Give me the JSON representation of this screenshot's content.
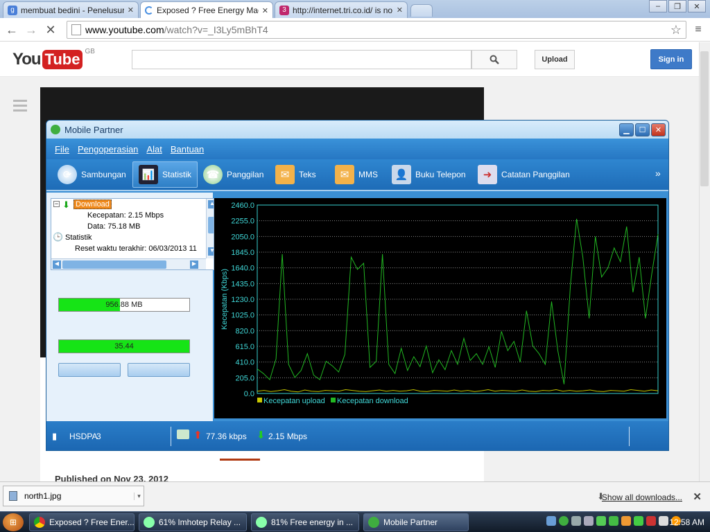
{
  "browser": {
    "tabs": [
      {
        "title": "membuat bedini - Penelusuran",
        "icon": "google-icon"
      },
      {
        "title": "Exposed ? Free Energy Magnet",
        "icon": "loading-icon",
        "active": true
      },
      {
        "title": "http://internet.tri.co.id/ is no",
        "icon": "tri-icon"
      }
    ],
    "url_host": "www.youtube.com",
    "url_path": "/watch?v=_I3Ly5mBhT4"
  },
  "youtube": {
    "logo_you": "You",
    "logo_tube": "Tube",
    "region": "GB",
    "upload_label": "Upload",
    "signin_label": "Sign in",
    "published": "Published on Nov 23, 2012"
  },
  "mobile_partner": {
    "title": "Mobile Partner",
    "menu": [
      "File",
      "Pengoperasian",
      "Alat",
      "Bantuan"
    ],
    "toolbar": [
      {
        "label": "Sambungan",
        "icon": "connection-icon"
      },
      {
        "label": "Statistik",
        "icon": "statistics-icon",
        "selected": true
      },
      {
        "label": "Panggilan",
        "icon": "phone-icon"
      },
      {
        "label": "Teks",
        "icon": "envelope-icon"
      },
      {
        "label": "MMS",
        "icon": "mms-icon"
      },
      {
        "label": "Buku Telepon",
        "icon": "phonebook-icon"
      },
      {
        "label": "Catatan Panggilan",
        "icon": "call-log-icon"
      }
    ],
    "tree": {
      "download": "Download",
      "speed": "Kecepatan: 2.15 Mbps",
      "data": "Data: 75.18 MB",
      "statistik": "Statistik",
      "reset": "Reset waktu terakhir: 06/03/2013 11"
    },
    "bar1": {
      "label": "956.88 MB",
      "fill": 0.47
    },
    "bar2": {
      "label": "35.44",
      "fill": 1.0
    },
    "status": {
      "network": "HSDPA",
      "signal": "3",
      "upload": "77.36 kbps",
      "download": "2.15 Mbps"
    }
  },
  "chart_data": {
    "type": "line",
    "ylabel": "Kecepatan (Kbps)",
    "ylim": [
      0,
      2460
    ],
    "yticks": [
      "0.0",
      "205.0",
      "410.0",
      "615.0",
      "820.0",
      "1025.0",
      "1230.0",
      "1435.0",
      "1640.0",
      "1845.0",
      "2050.0",
      "2255.0",
      "2460.0"
    ],
    "series": [
      {
        "name": "Kecepatan upload",
        "color": "#c8c800",
        "values": [
          30,
          40,
          25,
          35,
          50,
          30,
          20,
          45,
          30,
          25,
          40,
          35,
          30,
          50,
          40,
          30,
          25,
          35,
          45,
          30,
          40,
          30,
          35,
          50,
          30,
          25,
          40,
          35,
          30,
          45,
          30,
          40,
          25,
          35,
          50,
          30,
          40,
          35,
          30,
          45,
          30,
          25,
          40,
          35,
          50,
          30,
          40,
          30,
          35,
          45,
          30,
          25,
          40,
          35,
          30,
          50,
          40,
          30,
          45,
          35
        ]
      },
      {
        "name": "Kecepatan download",
        "color": "#22b822",
        "values": [
          320,
          260,
          180,
          450,
          1820,
          380,
          210,
          300,
          520,
          240,
          180,
          420,
          360,
          280,
          510,
          1780,
          1620,
          1700,
          340,
          420,
          1820,
          380,
          260,
          590,
          300,
          480,
          350,
          620,
          270,
          440,
          310,
          560,
          380,
          720,
          430,
          520,
          380,
          610,
          340,
          810,
          560,
          680,
          410,
          1080,
          620,
          520,
          380,
          1200,
          560,
          120,
          1400,
          2280,
          1780,
          980,
          2050,
          1520,
          1640,
          1900,
          1720,
          2180,
          1320,
          1780,
          980,
          1560,
          2080
        ]
      }
    ],
    "legend_position": "bottom-left",
    "grid": true
  },
  "downloads": {
    "file": "north1.jpg",
    "show_all": "Show all downloads..."
  },
  "taskbar": {
    "items": [
      "Exposed ? Free Ener...",
      "61% Imhotep Relay ...",
      "81% Free energy in ...",
      "Mobile Partner"
    ],
    "clock": "12:58 AM"
  }
}
